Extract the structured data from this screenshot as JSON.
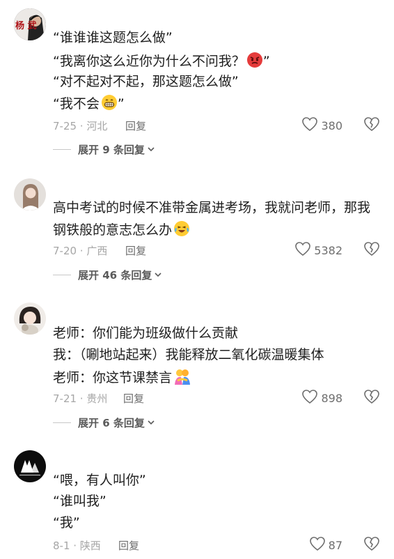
{
  "comments": [
    {
      "lines": [
        "“谁谁谁这题怎么做”",
        "“我离你这么近你为什么不问我？",
        "“对不起对不起，那这题怎么做”",
        "“我不会"
      ],
      "line_suffix": [
        "",
        "”",
        "",
        "”"
      ],
      "date_location": "7-25 · 河北",
      "reply_label": "回复",
      "likes": "380",
      "expand_label": "展开 9 条回复",
      "avatar_text": "杨 武"
    },
    {
      "lines": [
        "高中考试的时候不准带金属进考场，我就问老师，那我",
        "钢铁般的意志怎么办"
      ],
      "date_location": "7-20 · 广西",
      "reply_label": "回复",
      "likes": "5382",
      "expand_label": "展开 46 条回复"
    },
    {
      "lines": [
        "老师：你们能为班级做什么贡献",
        "我：（唰地站起来）我能释放二氧化碳温暖集体",
        "老师：你这节课禁言"
      ],
      "date_location": "7-21 · 贵州",
      "reply_label": "回复",
      "likes": "898",
      "expand_label": "展开 6 条回复"
    },
    {
      "lines": [
        "“喂，有人叫你”",
        "“谁叫我”",
        "“我”"
      ],
      "date_location": "8-1 · 陕西",
      "reply_label": "回复",
      "likes": "87"
    }
  ]
}
